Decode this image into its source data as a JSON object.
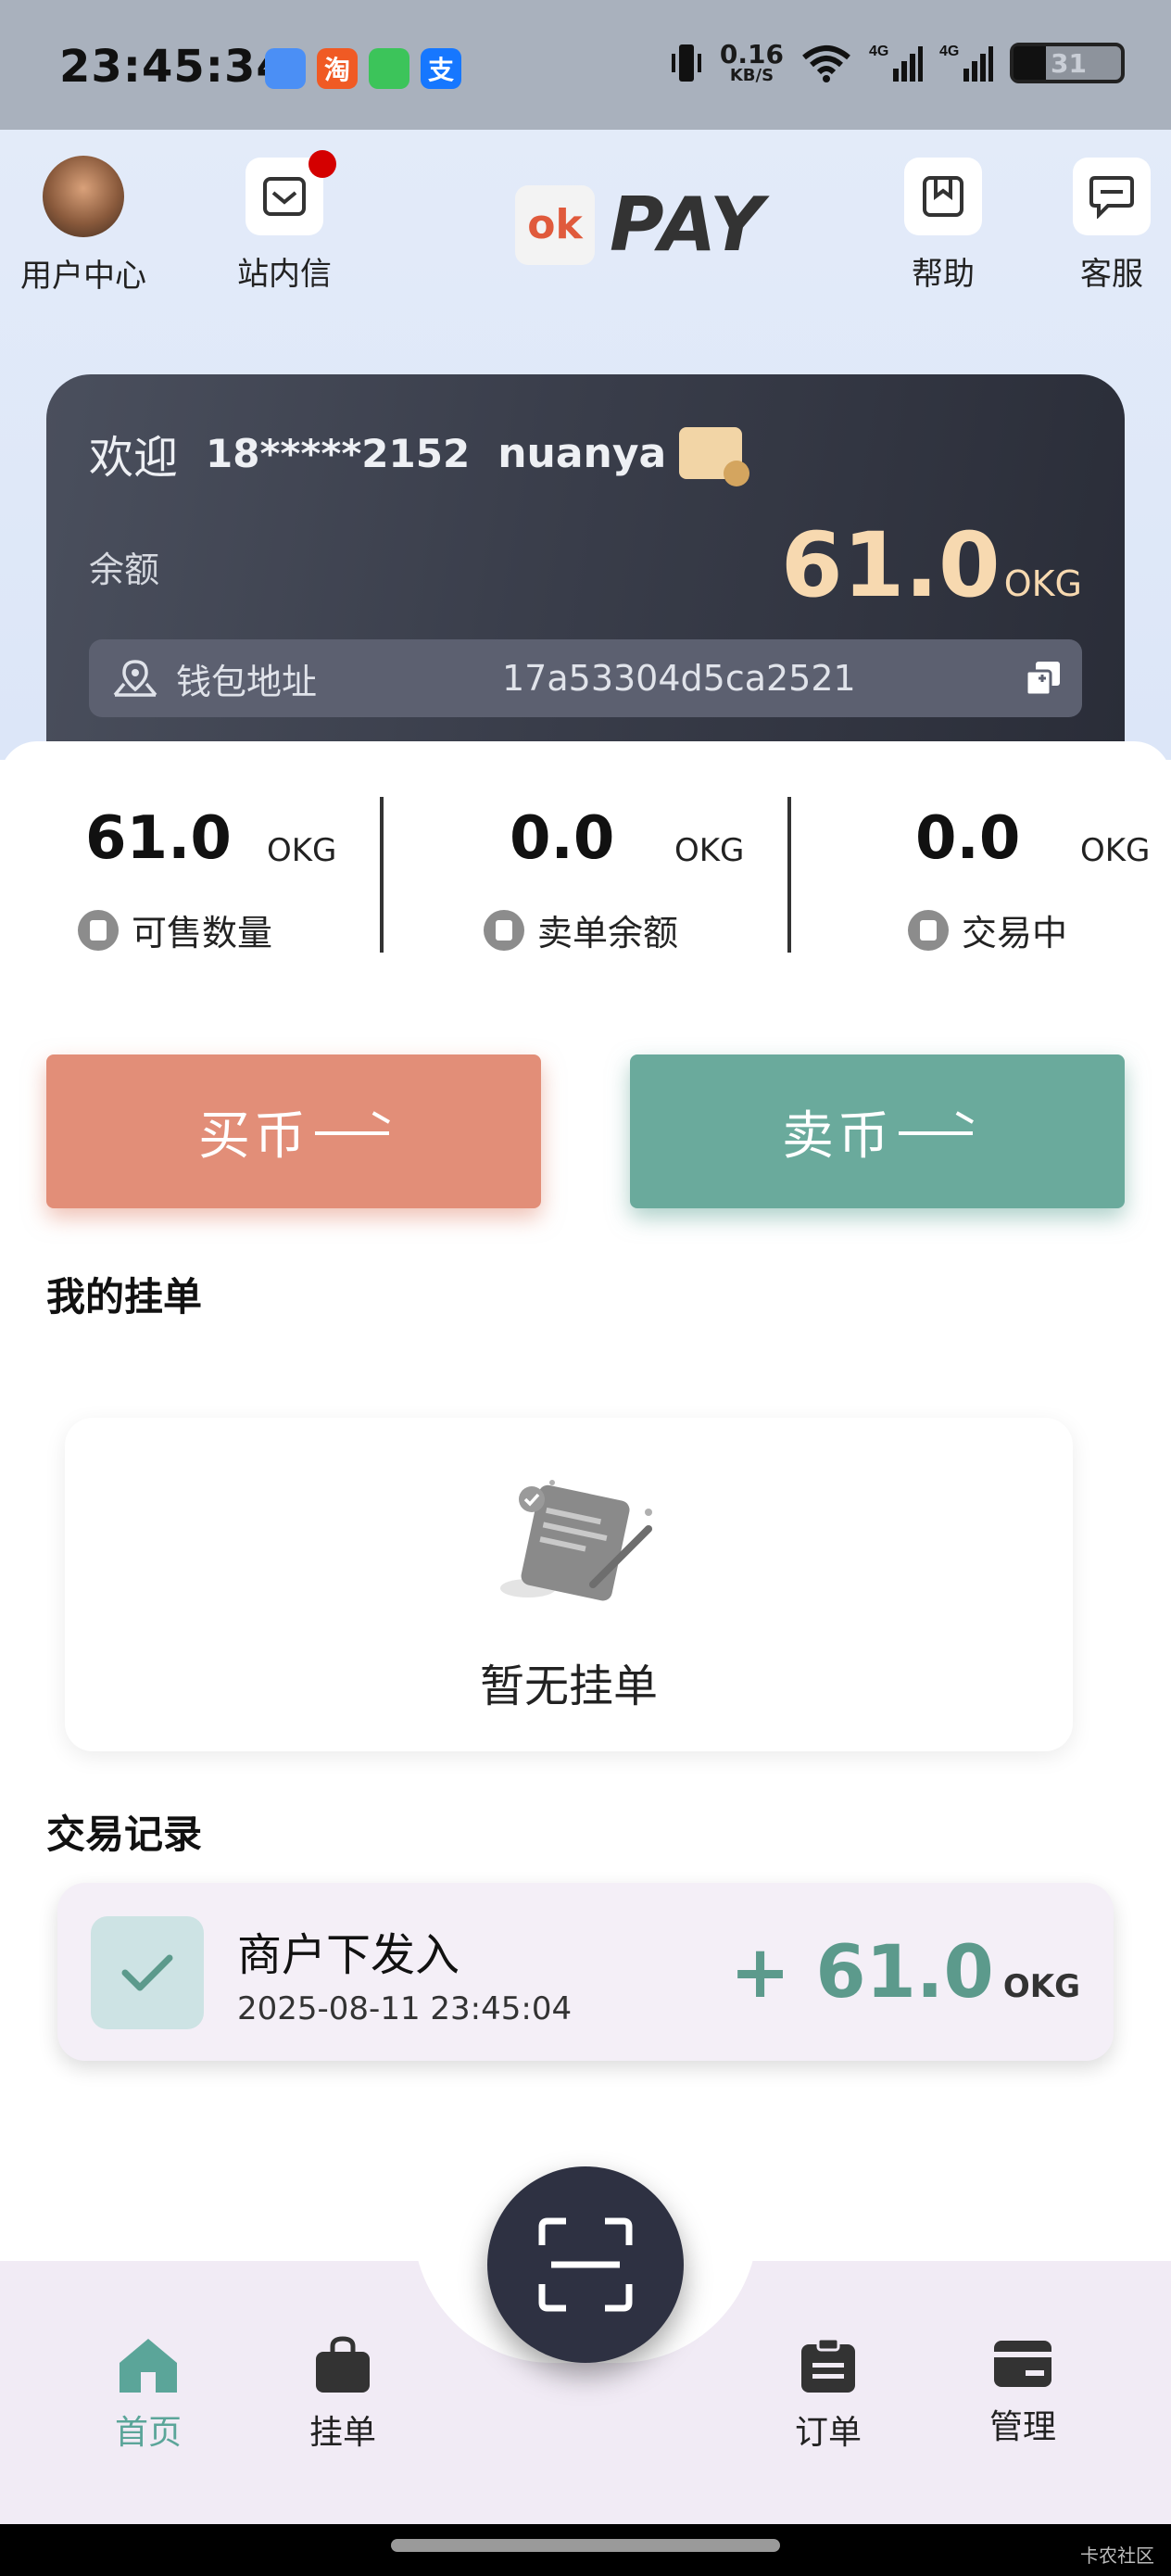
{
  "status_bar": {
    "time": "23:45:34",
    "net_speed_value": "0.16",
    "net_speed_unit": "KB/S",
    "battery_level": "31",
    "app_icons": [
      "weather-icon",
      "taobao-icon",
      "messages-icon",
      "alipay-icon"
    ],
    "app_icon_glyphs": [
      "",
      "淘",
      "",
      "支"
    ]
  },
  "header": {
    "user_center_label": "用户中心",
    "inbox_label": "站内信",
    "brand_logo_text": "ok",
    "brand_text": "PAY",
    "help_label": "帮助",
    "service_label": "客服"
  },
  "wallet": {
    "welcome_label": "欢迎",
    "phone": "18*****2152",
    "username": "nuanya",
    "balance_label": "余额",
    "balance_value": "61.0",
    "balance_unit": "OKG",
    "address_label": "钱包地址",
    "address_value": "17a53304d5ca2521"
  },
  "stats": [
    {
      "value": "61.0",
      "unit": "OKG",
      "label": "可售数量"
    },
    {
      "value": "0.0",
      "unit": "OKG",
      "label": "卖单余额"
    },
    {
      "value": "0.0",
      "unit": "OKG",
      "label": "交易中"
    }
  ],
  "actions": {
    "buy_label": "买币",
    "sell_label": "卖币"
  },
  "my_orders": {
    "title": "我的挂单",
    "empty_text": "暂无挂单"
  },
  "transactions": {
    "title": "交易记录",
    "items": [
      {
        "title": "商户下发入",
        "time": "2025-08-11 23:45:04",
        "amount": "+ 61.0",
        "unit": "OKG"
      }
    ]
  },
  "bottom_nav": {
    "tabs": [
      {
        "label": "首页",
        "active": true
      },
      {
        "label": "挂单",
        "active": false
      },
      {
        "label": "订单",
        "active": false
      },
      {
        "label": "管理",
        "active": false
      }
    ]
  },
  "watermark": "卡农社区",
  "colors": {
    "accent_green": "#5ba599",
    "buy": "#e28e78",
    "sell": "#6aaa9c",
    "balance_gold": "#f7d9b0",
    "card_dark": "#3a3e4b"
  }
}
